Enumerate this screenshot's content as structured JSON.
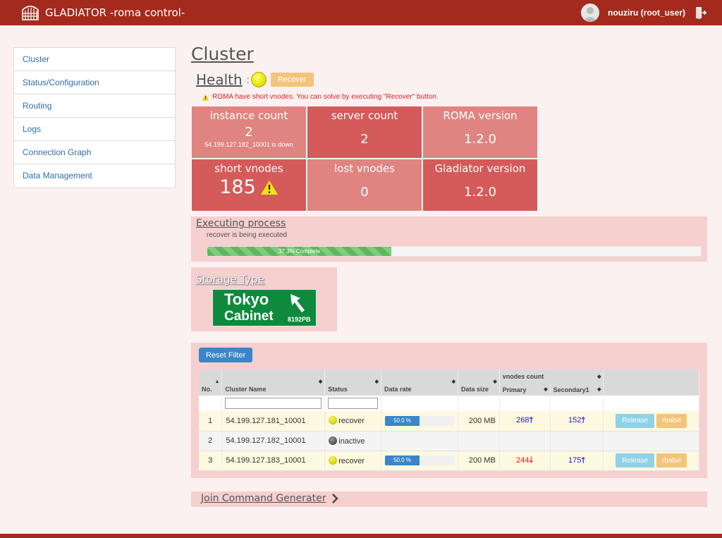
{
  "header": {
    "brand": "GLADIATOR",
    "subtitle": "-roma control-",
    "user": "nouziru (root_user)"
  },
  "sidebar": {
    "items": [
      {
        "label": "Cluster"
      },
      {
        "label": "Status/Configuration"
      },
      {
        "label": "Routing"
      },
      {
        "label": "Logs"
      },
      {
        "label": "Connection Graph"
      },
      {
        "label": "Data Management"
      }
    ]
  },
  "main": {
    "title": "Cluster",
    "health": {
      "title": "Health",
      "colon": ":",
      "recover_label": "Recover",
      "warning": "ROMA have short vnodes. You can solve by executing \"Recover\" button."
    },
    "stats": {
      "instance_count": {
        "label": "instance count",
        "value": "2",
        "sub": "54.199.127.182_10001 is down"
      },
      "server_count": {
        "label": "server count",
        "value": "2"
      },
      "roma_version": {
        "label": "ROMA version",
        "value": "1.2.0"
      },
      "short_vnodes": {
        "label": "short vnodes",
        "value": "185"
      },
      "lost_vnodes": {
        "label": "lost vnodes",
        "value": "0"
      },
      "gladiator_version": {
        "label": "Gladiator version",
        "value": "1.2.0"
      }
    },
    "executing": {
      "title": "Executing process",
      "message": "recover is being executed",
      "progress_label": "37.3% Complete",
      "progress": 37.3
    },
    "storage": {
      "title": "Storage Type",
      "sign_line1": "Tokyo",
      "sign_line2": "Cabinet",
      "sign_size": "8192PB"
    },
    "table": {
      "reset_label": "Reset Filter",
      "headers": {
        "no": "No.",
        "cluster_name": "Cluster Name",
        "status": "Status",
        "data_rate": "Data rate",
        "data_size": "Data size",
        "vnodes": "vnodes count",
        "primary": "Primary",
        "secondary": "Secondary1"
      },
      "rows": [
        {
          "no": "1",
          "name": "54.199.127.181_10001",
          "status": "recover",
          "rate": "50.0 %",
          "size": "200 MB",
          "primary": "268",
          "secondary": "152",
          "release": "Release",
          "rbalse": "rbalse"
        },
        {
          "no": "2",
          "name": "54.199.127.182_10001",
          "status": "inactive"
        },
        {
          "no": "3",
          "name": "54.199.127.183_10001",
          "status": "recover",
          "rate": "50.0 %",
          "size": "200 MB",
          "primary": "244",
          "secondary": "175",
          "release": "Release",
          "rbalse": "rbalse"
        }
      ]
    },
    "join": {
      "label": "Join Command Generater"
    }
  },
  "colors": {
    "header": "#a52a1e",
    "cell_light": "#df8480",
    "cell_dark": "#d55a5a",
    "panel": "#f6cfcf",
    "primary_button": "#3a86c8",
    "warning_button": "#f3c47a"
  }
}
